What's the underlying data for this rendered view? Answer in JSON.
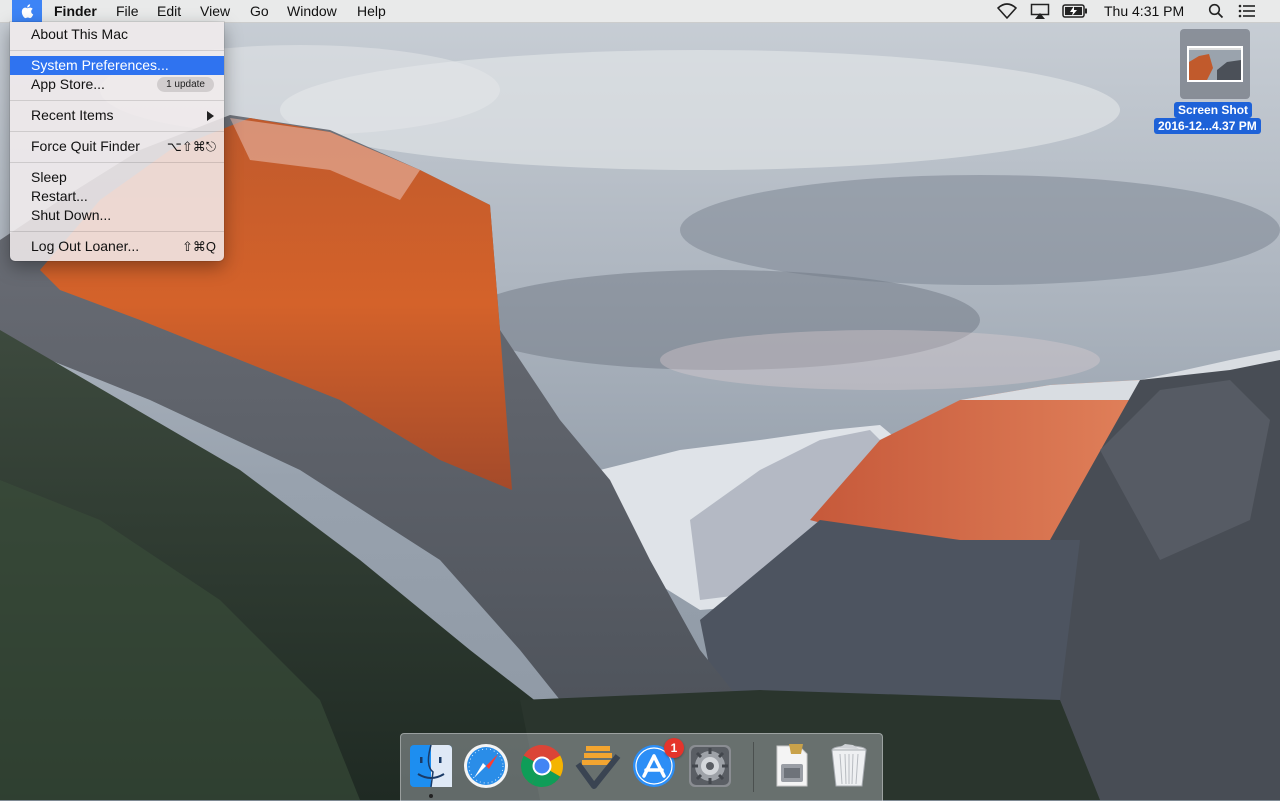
{
  "menubar": {
    "app_name": "Finder",
    "menus": [
      "File",
      "Edit",
      "View",
      "Go",
      "Window",
      "Help"
    ],
    "clock": "Thu 4:31 PM",
    "icons": [
      "apple-icon",
      "wifi-icon",
      "airplay-icon",
      "battery-charging-icon",
      "spotlight-search-icon",
      "notification-center-icon"
    ]
  },
  "apple_menu": {
    "about": "About This Mac",
    "system_preferences": "System Preferences...",
    "app_store": "App Store...",
    "app_store_badge": "1 update",
    "recent_items": "Recent Items",
    "force_quit": "Force Quit Finder",
    "force_quit_shortcut": "⌥⇧⌘⎋",
    "sleep": "Sleep",
    "restart": "Restart...",
    "shut_down": "Shut Down...",
    "log_out": "Log Out Loaner...",
    "log_out_shortcut": "⇧⌘Q",
    "highlighted": "System Preferences..."
  },
  "desktop_file": {
    "name_line1": "Screen Shot",
    "name_line2": "2016-12...4.37 PM"
  },
  "dock": {
    "items": [
      "Finder",
      "Safari",
      "Google Chrome",
      "To-Do App",
      "App Store",
      "System Preferences",
      "Installer",
      "Trash"
    ],
    "app_store_badge": "1"
  },
  "colors": {
    "menu_highlight": "#2f73f0",
    "badge_red": "#e5342b",
    "file_label_blue": "#1e62d8"
  }
}
